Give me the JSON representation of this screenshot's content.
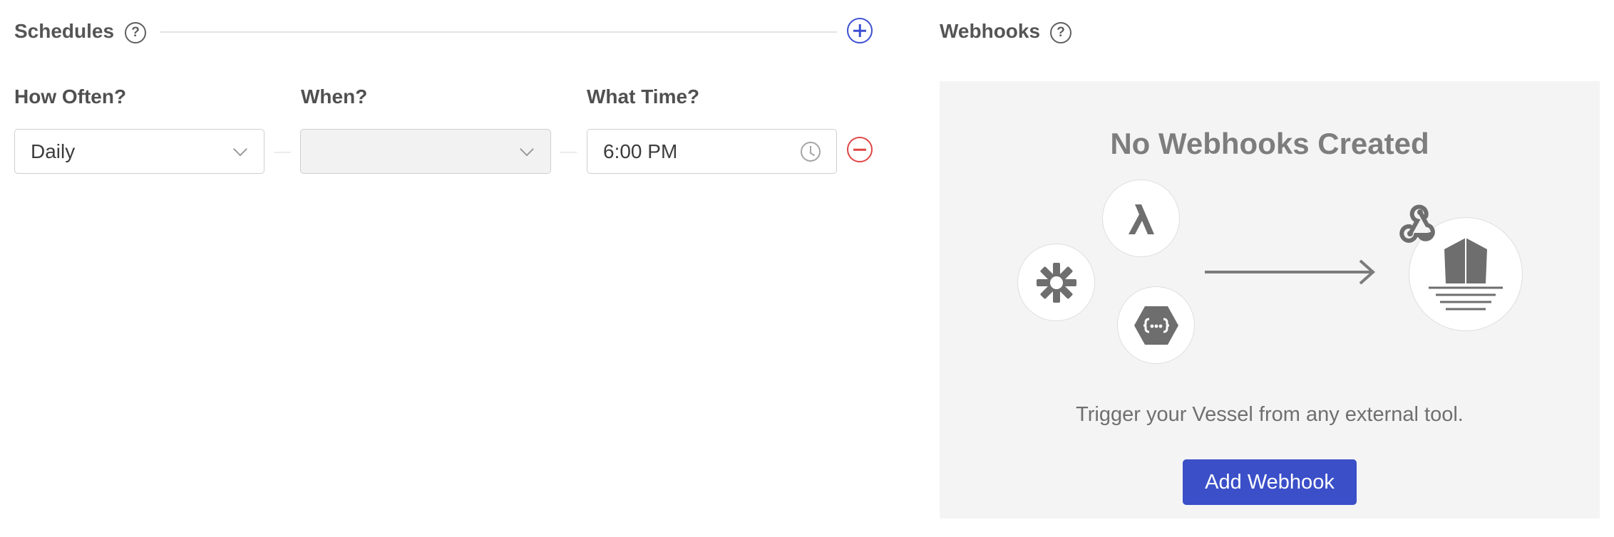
{
  "schedules": {
    "title": "Schedules",
    "help_glyph": "?",
    "labels": {
      "how_often": "How Often?",
      "when": "When?",
      "what_time": "What Time?"
    },
    "row": {
      "frequency": "Daily",
      "when": "",
      "time": "6:00 PM"
    },
    "icons": {
      "add": "plus-circle-icon",
      "remove": "minus-circle-icon",
      "clock": "clock-icon",
      "dropdown": "chevron-down-icon"
    }
  },
  "webhooks": {
    "title": "Webhooks",
    "help_glyph": "?",
    "empty_title": "No Webhooks Created",
    "description": "Trigger your Vessel from any external tool.",
    "button_label": "Add Webhook",
    "icons": [
      "zapier-icon",
      "lambda-icon",
      "cloud-functions-icon",
      "webhook-icon",
      "vessel-logo-icon"
    ]
  },
  "colors": {
    "accent": "#3b4fc8",
    "danger": "#e04545",
    "panel_bg": "#f4f4f4"
  }
}
